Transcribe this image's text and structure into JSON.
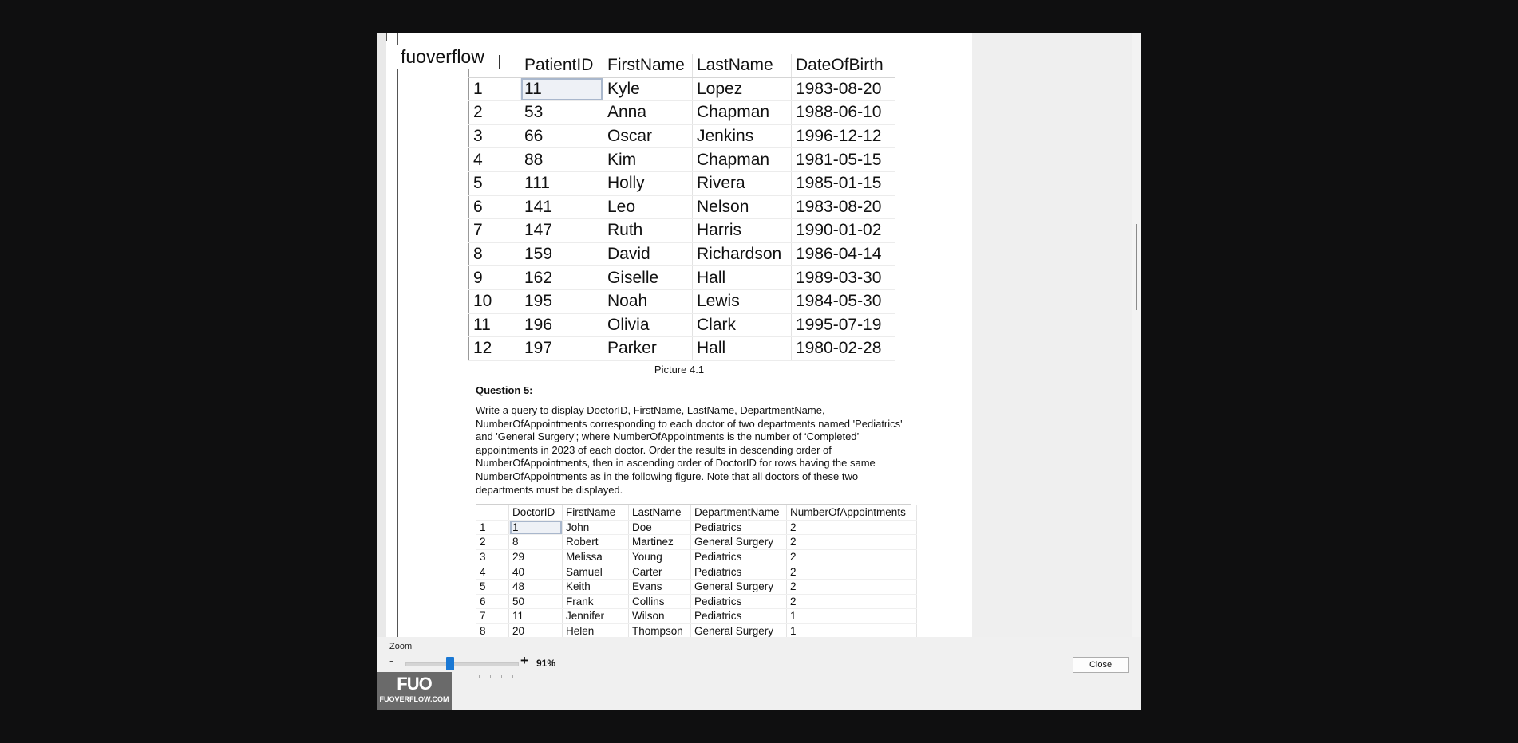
{
  "watermark": "fuoverflow",
  "patients_table": {
    "columns": [
      "",
      "PatientID",
      "FirstName",
      "LastName",
      "DateOfBirth"
    ],
    "rows": [
      [
        "1",
        "11",
        "Kyle",
        "Lopez",
        "1983-08-20"
      ],
      [
        "2",
        "53",
        "Anna",
        "Chapman",
        "1988-06-10"
      ],
      [
        "3",
        "66",
        "Oscar",
        "Jenkins",
        "1996-12-12"
      ],
      [
        "4",
        "88",
        "Kim",
        "Chapman",
        "1981-05-15"
      ],
      [
        "5",
        "111",
        "Holly",
        "Rivera",
        "1985-01-15"
      ],
      [
        "6",
        "141",
        "Leo",
        "Nelson",
        "1983-08-20"
      ],
      [
        "7",
        "147",
        "Ruth",
        "Harris",
        "1990-01-02"
      ],
      [
        "8",
        "159",
        "David",
        "Richardson",
        "1986-04-14"
      ],
      [
        "9",
        "162",
        "Giselle",
        "Hall",
        "1989-03-30"
      ],
      [
        "10",
        "195",
        "Noah",
        "Lewis",
        "1984-05-30"
      ],
      [
        "11",
        "196",
        "Olivia",
        "Clark",
        "1995-07-19"
      ],
      [
        "12",
        "197",
        "Parker",
        "Hall",
        "1980-02-28"
      ]
    ]
  },
  "caption": "Picture 4.1",
  "question": {
    "heading": "Question 5:",
    "body": "Write a query to display DoctorID, FirstName, LastName, DepartmentName, NumberOfAppointments corresponding to each doctor of two departments named 'Pediatrics' and 'General Surgery'; where NumberOfAppointments is the number of ‘Completed’ appointments in 2023 of each doctor. Order the results in descending order of NumberOfAppointments, then in ascending order of DoctorID for rows having the same NumberOfAppointments as in the following figure. Note that all doctors of these two departments must be displayed."
  },
  "doctors_table": {
    "columns": [
      "",
      "DoctorID",
      "FirstName",
      "LastName",
      "DepartmentName",
      "NumberOfAppointments"
    ],
    "rows": [
      [
        "1",
        "1",
        "John",
        "Doe",
        "Pediatrics",
        "2"
      ],
      [
        "2",
        "8",
        "Robert",
        "Martinez",
        "General Surgery",
        "2"
      ],
      [
        "3",
        "29",
        "Melissa",
        "Young",
        "Pediatrics",
        "2"
      ],
      [
        "4",
        "40",
        "Samuel",
        "Carter",
        "Pediatrics",
        "2"
      ],
      [
        "5",
        "48",
        "Keith",
        "Evans",
        "General Surgery",
        "2"
      ],
      [
        "6",
        "50",
        "Frank",
        "Collins",
        "Pediatrics",
        "2"
      ],
      [
        "7",
        "11",
        "Jennifer",
        "Wilson",
        "Pediatrics",
        "1"
      ],
      [
        "8",
        "20",
        "Helen",
        "Thompson",
        "General Surgery",
        "1"
      ]
    ]
  },
  "zoom": {
    "label": "Zoom",
    "minus": "-",
    "plus": "+",
    "value_text": "91%",
    "level": 0.91
  },
  "close_label": "Close",
  "logo": {
    "mark": "FUO",
    "text": "FUOVERFLOW.COM"
  },
  "colors": {
    "slider": "#1a78d4",
    "background": "#0f0f10"
  }
}
